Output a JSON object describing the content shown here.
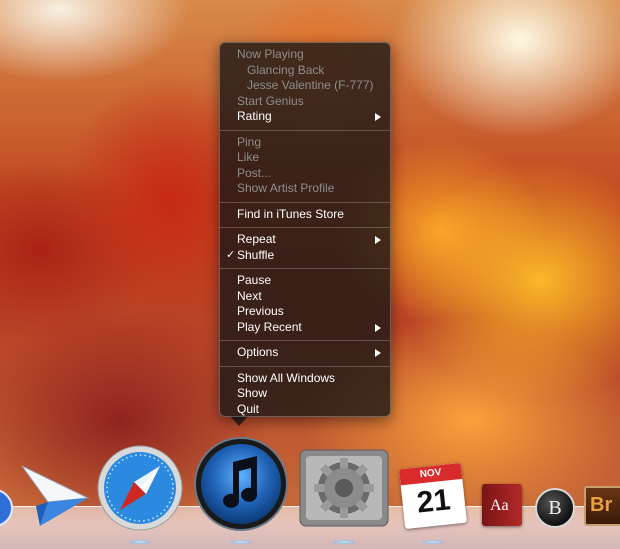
{
  "menu": {
    "now_playing_header": "Now Playing",
    "track_title": "Glancing Back",
    "track_artist": "Jesse Valentine (F-777)",
    "start_genius": "Start Genius",
    "rating": "Rating",
    "ping": "Ping",
    "like": "Like",
    "post": "Post...",
    "show_artist_profile": "Show Artist Profile",
    "find_in_store": "Find in iTunes Store",
    "repeat": "Repeat",
    "shuffle": "Shuffle",
    "shuffle_check": "✓",
    "pause": "Pause",
    "next": "Next",
    "previous": "Previous",
    "play_recent": "Play Recent",
    "options": "Options",
    "show_all_windows": "Show All Windows",
    "show": "Show",
    "quit": "Quit"
  },
  "dock": {
    "calendar_month": "NOV",
    "calendar_day": "21",
    "dictionary_label": "Aa",
    "bbedit_label": "B",
    "partial_app_label": "Br"
  },
  "colors": {
    "menu_text": "#ffffff",
    "menu_disabled_text": "#8e8e8e",
    "calendar_red": "#d92b2b"
  }
}
